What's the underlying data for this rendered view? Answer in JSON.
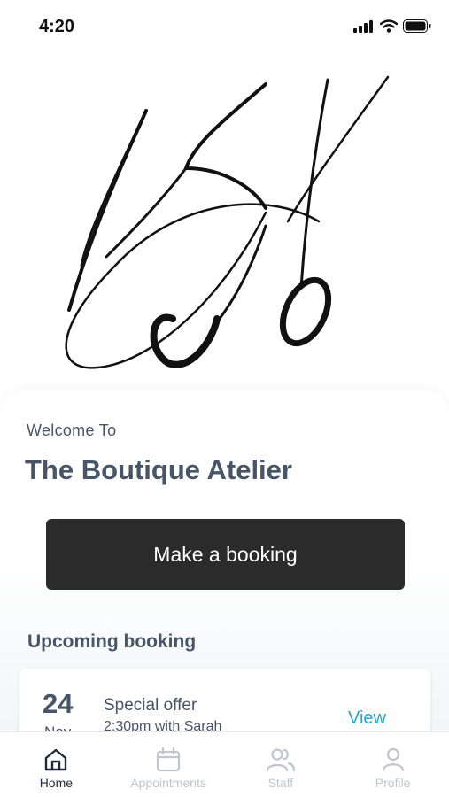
{
  "status_bar": {
    "time": "4:20"
  },
  "welcome": {
    "greeting": "Welcome To",
    "salon_name": "The Boutique Atelier"
  },
  "actions": {
    "make_booking_label": "Make a booking"
  },
  "upcoming": {
    "title": "Upcoming booking",
    "booking": {
      "day": "24",
      "month": "Nov",
      "title": "Special offer",
      "subtitle": "2:30pm with Sarah",
      "view_label": "View"
    }
  },
  "tab_bar": {
    "items": [
      {
        "label": "Home",
        "icon": "home-icon",
        "active": true
      },
      {
        "label": "Appointments",
        "icon": "calendar-icon",
        "active": false
      },
      {
        "label": "Staff",
        "icon": "users-icon",
        "active": false
      },
      {
        "label": "Profile",
        "icon": "user-icon",
        "active": false
      }
    ]
  },
  "colors": {
    "accent": "#2aa5c8",
    "primary_button": "#2b2b2b",
    "heading": "#475569",
    "inactive_tab": "#c0c6ce"
  }
}
